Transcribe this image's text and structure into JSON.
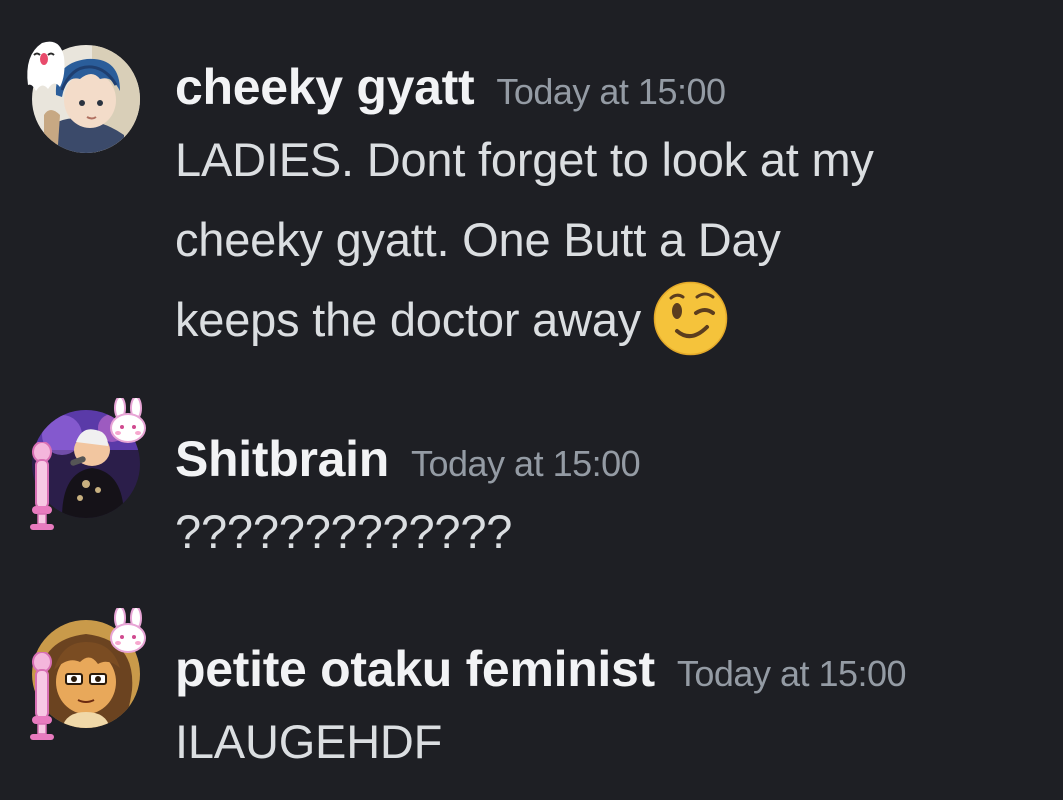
{
  "messages": [
    {
      "username": "cheeky gyatt",
      "timestamp": "Today at 15:00",
      "lines": [
        "LADIES. Dont forget to look at my",
        "cheeky gyatt. One Butt a Day",
        "keeps the doctor away"
      ],
      "emoji": "winking-face-emoji",
      "avatar": "anime-boy-avatar",
      "decoration": "ghost-decoration"
    },
    {
      "username": "Shitbrain",
      "timestamp": "Today at 15:00",
      "lines": [
        "?????????????"
      ],
      "avatar": "concert-singer-avatar",
      "decoration": "bunny-microphone-decoration"
    },
    {
      "username": "petite otaku feminist",
      "timestamp": "Today at 15:00",
      "lines": [
        "ILAUGEHDF"
      ],
      "avatar": "drawn-character-avatar",
      "decoration": "bunny-microphone-decoration"
    }
  ],
  "colors": {
    "background": "#1e1f24",
    "username": "#f2f3f5",
    "timestamp": "#949ba4",
    "text": "#dbdee1",
    "emoji": "#f5c33b"
  }
}
